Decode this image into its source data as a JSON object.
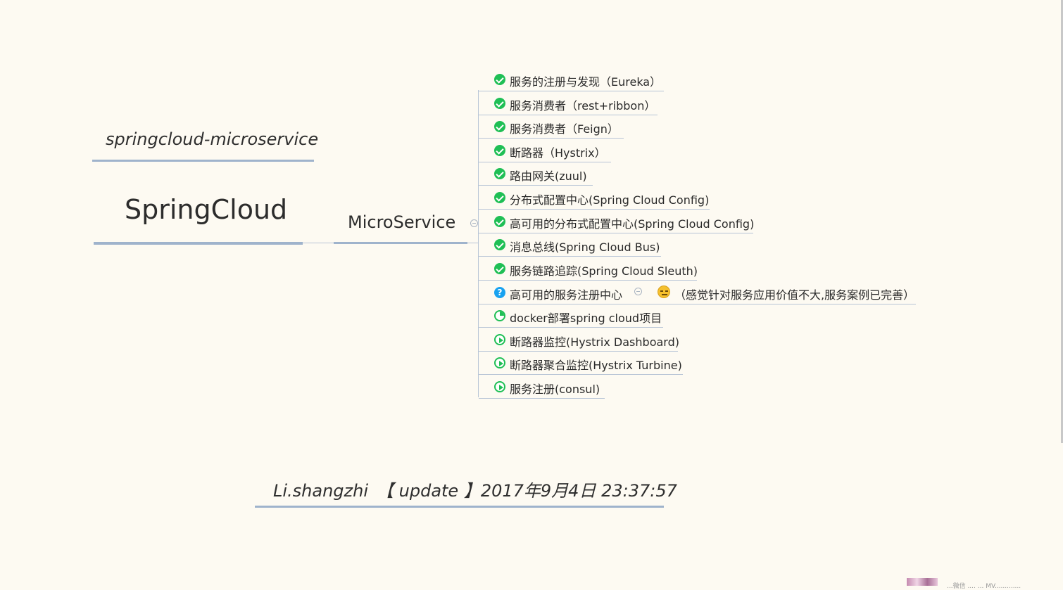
{
  "subtitle": "springcloud-microservice",
  "root_topic": "SpringCloud",
  "main_branch": "MicroService",
  "footer": "Li.shangzhi　【 update 】2017年9月4日 23:37:57",
  "status_text": "...微信 .... ... MV.............",
  "colors": {
    "done": "#1fbf55",
    "question": "#18a2f0",
    "underline": "#9fb3cc",
    "background": "#fdfaf2"
  },
  "items": [
    {
      "label": "服务的注册与发现（Eureka）",
      "marker": "check-done-icon"
    },
    {
      "label": "服务消费者（rest+ribbon）",
      "marker": "check-done-icon"
    },
    {
      "label": "服务消费者（Feign）",
      "marker": "check-done-icon"
    },
    {
      "label": "断路器（Hystrix）",
      "marker": "check-done-icon"
    },
    {
      "label": "路由网关(zuul)",
      "marker": "check-done-icon"
    },
    {
      "label": "分布式配置中心(Spring Cloud Config)",
      "marker": "check-done-icon"
    },
    {
      "label": "高可用的分布式配置中心(Spring Cloud Config)",
      "marker": "check-done-icon"
    },
    {
      "label": "消息总线(Spring Cloud Bus)",
      "marker": "check-done-icon"
    },
    {
      "label": "服务链路追踪(Spring Cloud Sleuth)",
      "marker": "check-done-icon"
    },
    {
      "label": "高可用的服务注册中心",
      "marker": "question-icon",
      "child": "（感觉针对服务应用价值不大,服务案例已完善）",
      "child_marker": "expressionless-face-icon"
    },
    {
      "label": "docker部署spring cloud项目",
      "marker": "progress-partial-icon"
    },
    {
      "label": "断路器监控(Hystrix Dashboard)",
      "marker": "play-icon"
    },
    {
      "label": "断路器聚合监控(Hystrix Turbine)",
      "marker": "play-icon"
    },
    {
      "label": "服务注册(consul)",
      "marker": "play-icon"
    }
  ]
}
